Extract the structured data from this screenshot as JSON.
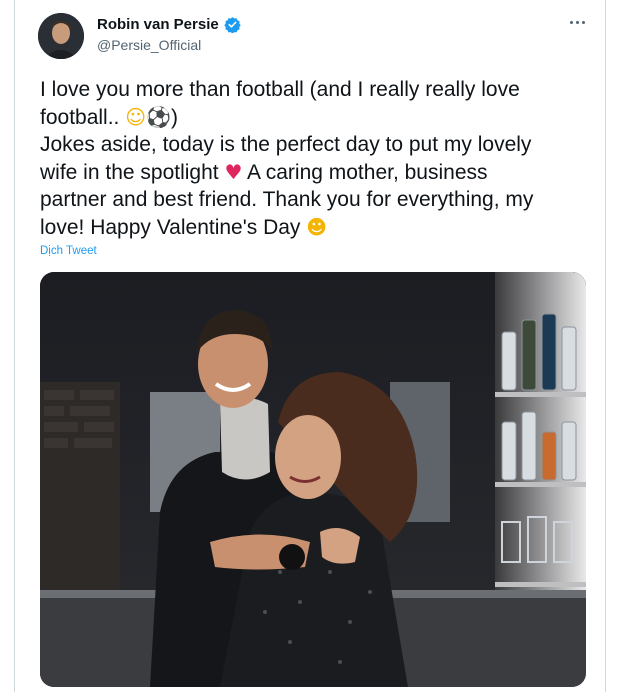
{
  "author": {
    "display_name": "Robin van Persie",
    "handle": "@Persie_Official",
    "verified": true
  },
  "tweet": {
    "lines": [
      {
        "text": "I love you more than football (and I really really love"
      },
      {
        "text": "football.. ",
        "emoji": [
          "joy-emoji",
          "soccer-ball-emoji"
        ],
        "tail": ")"
      },
      {
        "text": "Jokes aside, today is the perfect day to put my lovely"
      },
      {
        "text": "wife in the spotlight ",
        "emoji": [
          "red-heart-emoji"
        ],
        "tail": " A caring mother, business"
      },
      {
        "text": "partner and best friend. Thank you for everything, my"
      },
      {
        "text": "love! Happy Valentine's Day ",
        "emoji": [
          "kiss-emoji"
        ]
      }
    ]
  },
  "translate_label": "Dịch Tweet",
  "colors": {
    "verified_badge": "#1d9bf0",
    "link": "#1d9bf0",
    "text": "#0f1419",
    "secondary": "#536471"
  },
  "media": {
    "icon": "photo-icon"
  }
}
